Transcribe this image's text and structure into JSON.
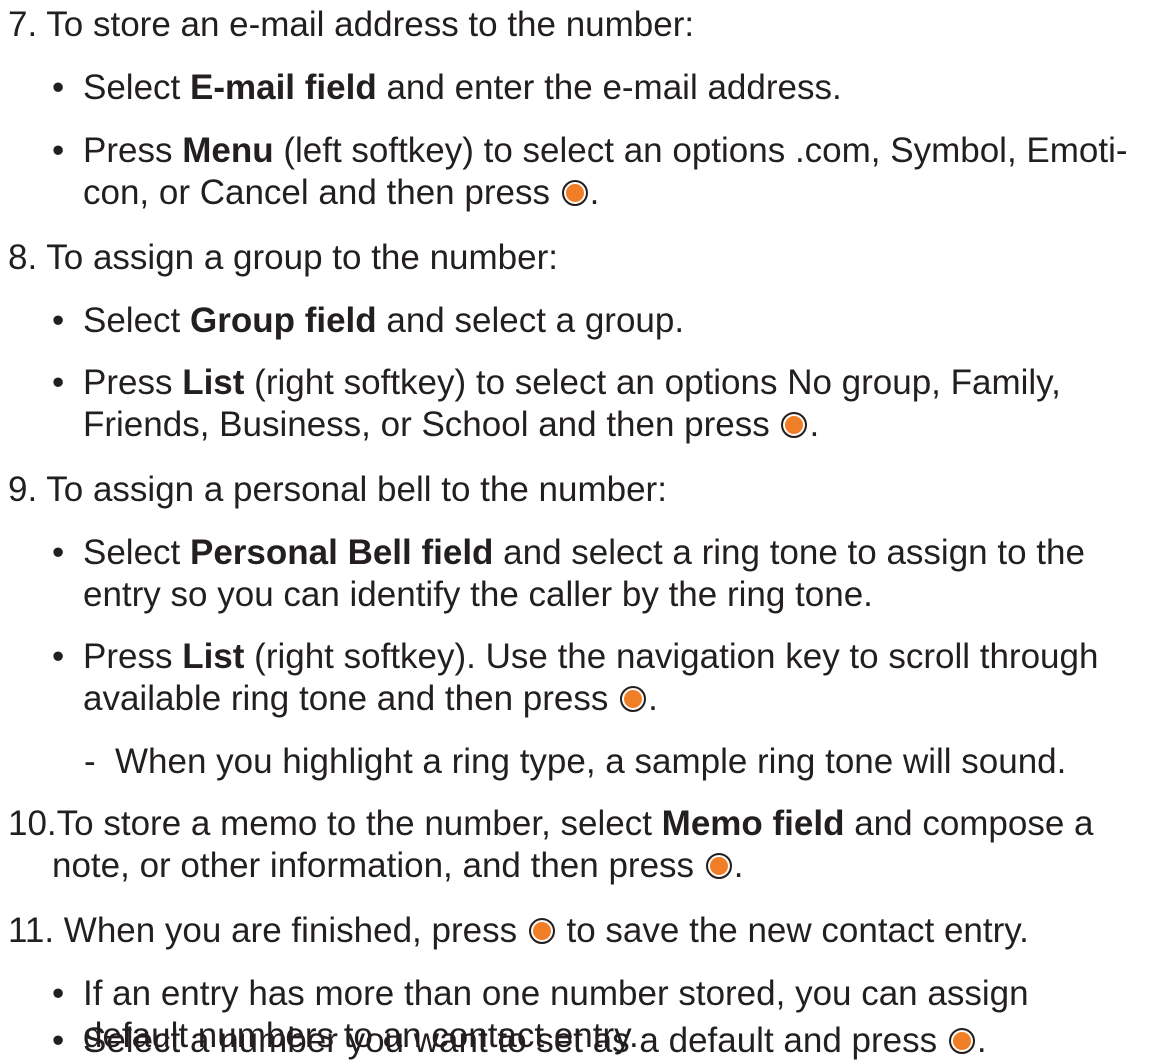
{
  "ok_key": {
    "icon": "ok-button-icon",
    "color": "#f07e26"
  },
  "steps": {
    "s7": {
      "text": "7.  To store an e-mail address to the number:",
      "b1": {
        "a": "Select ",
        "bold": "E-mail field",
        "b": " and enter the e-mail address."
      },
      "b2": {
        "a": "Press ",
        "bold": "Menu",
        "b": " (left softkey) to select an options .com, Symbol, Emoti-",
        "c": "con, or Cancel and then press ",
        "d": "."
      }
    },
    "s8": {
      "text": "8.  To assign a group to the number:",
      "b1": {
        "a": "Select ",
        "bold": "Group field",
        "b": " and select a group."
      },
      "b2": {
        "a": "Press ",
        "bold": "List",
        "b": " (right softkey) to select an options No group, Family,",
        "c": "Friends, Business, or School and then press ",
        "d": "."
      }
    },
    "s9": {
      "text": "9.  To assign a personal bell to the number:",
      "b1": {
        "a": "Select ",
        "bold": "Personal Bell field",
        "b": " and select a ring tone to assign to the",
        "c": "entry so you can identify the caller by the ring tone."
      },
      "b2": {
        "a": "Press ",
        "bold": "List",
        "b": " (right softkey). Use the navigation key to scroll through",
        "c": "available ring tone and then press ",
        "d": "."
      },
      "sub": {
        "dash": "-",
        "text": "When you highlight a ring type, a sample ring tone will sound."
      }
    },
    "s10": {
      "a": "10.To store a memo to the number, select ",
      "bold": "Memo field",
      "b": " and compose a",
      "c": "note, or other information, and then press ",
      "d": "."
    },
    "s11": {
      "a": "11. When you are finished, press ",
      "b": " to save the new contact entry.",
      "b1": {
        "a": "If an entry has more than one number stored, you can assign",
        "c": "default numbers to an contact entry."
      },
      "b2": {
        "a": "Select a number you want to set as a default and press ",
        "d": "."
      }
    }
  },
  "bullet_char": "•"
}
